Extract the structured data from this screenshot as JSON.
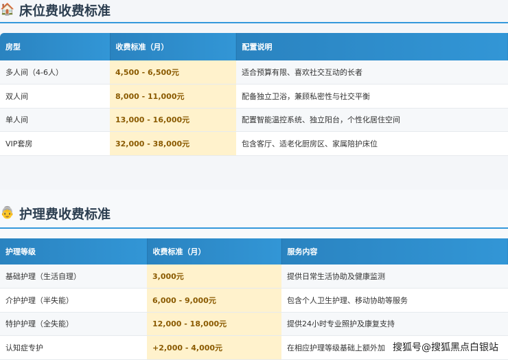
{
  "bed": {
    "title": "床位费收费标准",
    "icon": "house-icon",
    "headers": [
      "房型",
      "收费标准（月）",
      "配置说明"
    ],
    "rows": [
      [
        "多人间（4-6人）",
        "4,500 - 6,500元",
        "适合预算有限、喜欢社交互动的长者"
      ],
      [
        "双人间",
        "8,000 - 11,000元",
        "配备独立卫浴，兼顾私密性与社交平衡"
      ],
      [
        "单人间",
        "13,000 - 16,000元",
        "配置智能温控系统、独立阳台，个性化居住空间"
      ],
      [
        "VIP套房",
        "32,000 - 38,000元",
        "包含客厅、适老化厨房区、家属陪护床位"
      ]
    ]
  },
  "care": {
    "title": "护理费收费标准",
    "icon": "elderly-face-icon",
    "headers": [
      "护理等级",
      "收费标准（月）",
      "服务内容"
    ],
    "rows": [
      [
        "基础护理（生活自理）",
        "3,000元",
        "提供日常生活协助及健康监测"
      ],
      [
        "介护护理（半失能）",
        "6,000 - 9,000元",
        "包含个人卫生护理、移动协助等服务"
      ],
      [
        "特护护理（全失能）",
        "12,000 - 18,000元",
        "提供24小时专业照护及康复支持"
      ],
      [
        "认知症专护",
        "+2,000 - 4,000元",
        "在相应护理等级基础上额外加"
      ]
    ]
  },
  "watermark": "搜狐号@搜狐黑点白银站"
}
